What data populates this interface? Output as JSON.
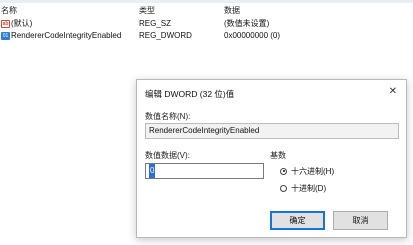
{
  "list": {
    "headers": {
      "name": "名称",
      "type": "类型",
      "data": "数据"
    },
    "rows": [
      {
        "icon": "string-value-icon",
        "name": "(默认)",
        "type": "REG_SZ",
        "data": "(数值未设置)"
      },
      {
        "icon": "dword-value-icon",
        "name": "RendererCodeIntegrityEnabled",
        "type": "REG_DWORD",
        "data": "0x00000000 (0)"
      }
    ]
  },
  "dialog": {
    "title": "编辑 DWORD (32 位)值",
    "close_glyph": "✕",
    "name_label": "数值名称(N):",
    "name_value": "RendererCodeIntegrityEnabled",
    "data_label": "数值数据(V):",
    "data_value": "0",
    "base_label": "基数",
    "base_options": [
      {
        "label": "十六进制(H)",
        "selected": true
      },
      {
        "label": "十进制(D)",
        "selected": false
      }
    ],
    "ok_label": "确定",
    "cancel_label": "取消"
  }
}
